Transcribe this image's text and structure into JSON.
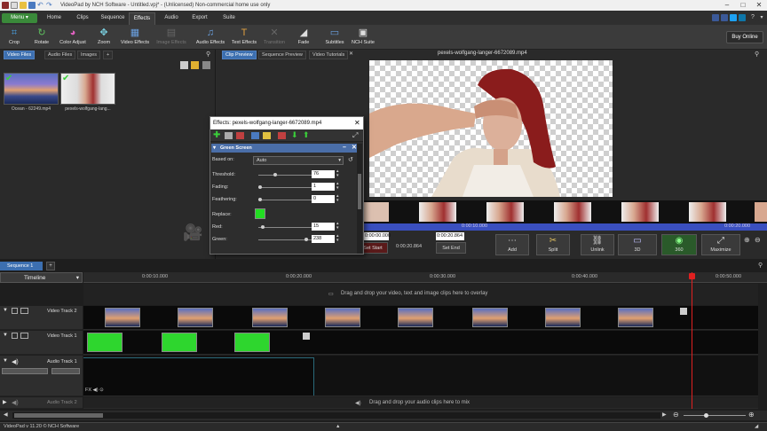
{
  "app": {
    "title": "VideoPad by NCH Software - Untitled.vpj* - (Unlicensed) Non-commercial home use only",
    "version_status": "VideoPad v 11.20 © NCH Software"
  },
  "menu": {
    "menu_button": "Menu",
    "tabs": [
      "Home",
      "Clips",
      "Sequence",
      "Effects",
      "Audio",
      "Export",
      "Suite"
    ],
    "active_tab": "Effects"
  },
  "toolbar": {
    "items": [
      {
        "label": "Crop",
        "icon": "crop-icon"
      },
      {
        "label": "Rotate",
        "icon": "rotate-icon"
      },
      {
        "label": "Color Adjust",
        "icon": "color-adjust-icon"
      },
      {
        "label": "Zoom",
        "icon": "zoom-icon"
      },
      {
        "label": "Video Effects",
        "icon": "video-effects-icon"
      },
      {
        "label": "Image Effects",
        "icon": "image-effects-icon"
      },
      {
        "label": "Audio Effects",
        "icon": "audio-effects-icon"
      },
      {
        "label": "Text Effects",
        "icon": "text-effects-icon"
      },
      {
        "label": "Transition",
        "icon": "transition-icon"
      },
      {
        "label": "Fade",
        "icon": "fade-icon"
      },
      {
        "label": "Subtitles",
        "icon": "subtitles-icon"
      },
      {
        "label": "NCH Suite",
        "icon": "nch-suite-icon"
      }
    ],
    "buy_online": "Buy Online"
  },
  "media_bin": {
    "tabs": [
      "Video Files",
      "Audio Files",
      "Images",
      "+"
    ],
    "active_tab": "Video Files",
    "files": [
      {
        "name": "Ocean - 62249.mp4"
      },
      {
        "name": "pexels-wolfgang-lang..."
      }
    ]
  },
  "preview": {
    "tabs": [
      "Clip Preview",
      "Sequence Preview",
      "Video Tutorials"
    ],
    "active_tab": "Clip Preview",
    "title": "pexels-wolfgang-langer-6672089.mp4",
    "current_time": "0:00:10.000",
    "end_time": "0:00:20.000",
    "set_start_time": "0:00:00.000",
    "duration": "0:00:20.864",
    "set_end_time": "0:00:20.864",
    "buttons": {
      "set_start": "Set Start",
      "set_end": "Set End",
      "add": "Add",
      "split": "Split",
      "unlink": "Unlink",
      "threed": "3D",
      "degrees": "360",
      "maximize": "Maximize"
    }
  },
  "effects_dialog": {
    "title": "Effects: pexels-wolfgang-langer-6672089.mp4",
    "section": "Green Screen",
    "based_on_label": "Based on:",
    "based_on_value": "Auto",
    "threshold_label": "Threshold:",
    "threshold_value": "76",
    "fading_label": "Fading:",
    "fading_value": "1",
    "feathering_label": "Feathering:",
    "feathering_value": "0",
    "replace_label": "Replace:",
    "replace_color": "#22dd22",
    "red_label": "Red:",
    "red_value": "15",
    "green_label": "Green:",
    "green_value": "238",
    "sliders": {
      "threshold": 0.3,
      "fading": 0.0,
      "feathering": 0.0,
      "red": 0.06,
      "green": 0.93
    }
  },
  "timeline": {
    "sequence_tab": "Sequence 1",
    "timeline_label": "Timeline",
    "ruler": [
      "0:00:10.000",
      "0:00:20.000",
      "0:00:30.000",
      "0:00:40.000",
      "0:00:50.000"
    ],
    "overlay_drop": "Drag and drop your video, text and image clips here to overlay",
    "tracks": [
      {
        "name": "Video Track 2"
      },
      {
        "name": "Video Track 1"
      },
      {
        "name": "Audio Track 1"
      },
      {
        "name": "Audio Track 2"
      }
    ],
    "audio_drop": "Drag and drop your audio clips here to mix"
  },
  "colors": {
    "accent_green": "#3a8a3a",
    "tab_blue": "#3c6fb0",
    "scrubber_blue": "#3a4fbf",
    "playhead_red": "#e02020",
    "green_screen": "#2ed62e"
  }
}
